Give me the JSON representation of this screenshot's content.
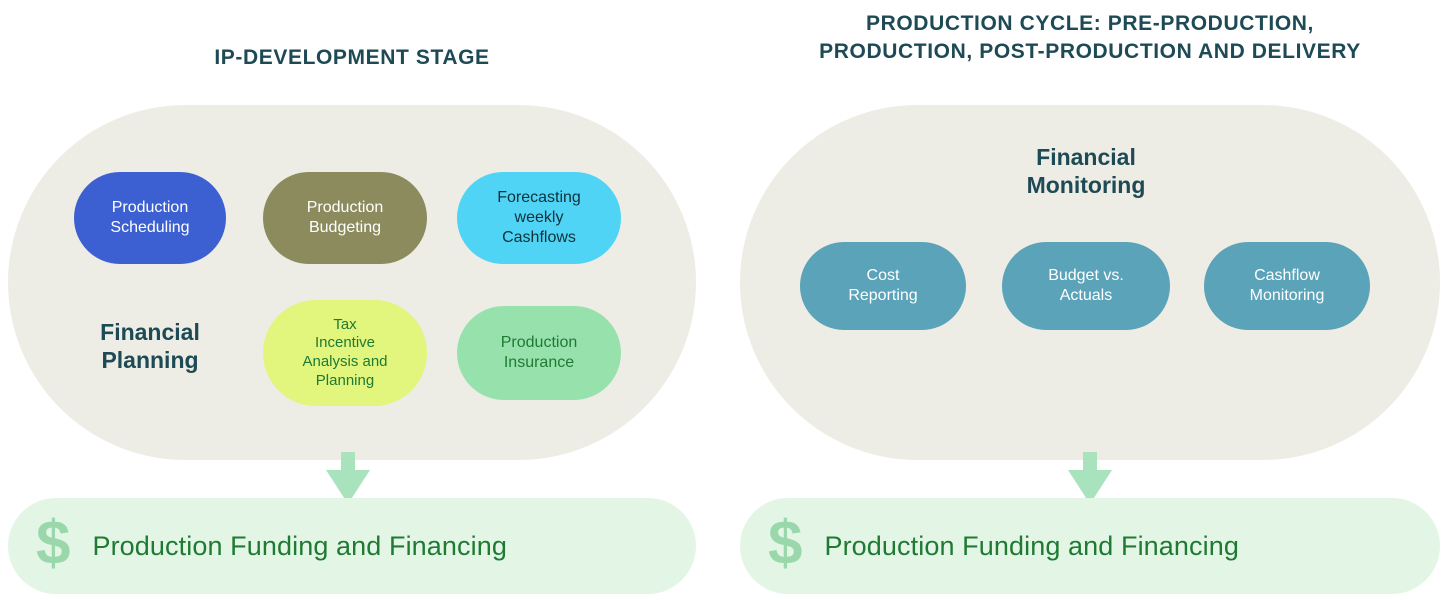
{
  "columns": [
    {
      "id": "ip-development",
      "title": "IP-DEVELOPMENT STAGE",
      "group_label": "Financial\nPlanning",
      "group_label_line1": "Financial",
      "group_label_line2": "Planning",
      "items": [
        {
          "label": "Production\nScheduling",
          "line1": "Production",
          "line2": "Scheduling",
          "color": "#3c60d1",
          "text_color": "#ffffff"
        },
        {
          "label": "Production\nBudgeting",
          "line1": "Production",
          "line2": "Budgeting",
          "color": "#8b8b5e",
          "text_color": "#ffffff"
        },
        {
          "label": "Forecasting\nweekly\nCashflows",
          "line1": "Forecasting",
          "line2": "weekly",
          "line3": "Cashflows",
          "color": "#4fd4f5",
          "text_color": "#10313a"
        },
        {
          "label": "Tax\nIncentive\nAnalysis and\nPlanning",
          "line1": "Tax",
          "line2": "Incentive",
          "line3": "Analysis and",
          "line4": "Planning",
          "color": "#e2f57d",
          "text_color": "#1f7a33"
        },
        {
          "label": "Production\nInsurance",
          "line1": "Production",
          "line2": "Insurance",
          "color": "#97e2ac",
          "text_color": "#1f7a33"
        }
      ],
      "footer": {
        "icon": "dollar-icon",
        "icon_glyph": "$",
        "label": "Production Funding and Financing"
      }
    },
    {
      "id": "production-cycle",
      "title": "PRODUCTION CYCLE: PRE-PRODUCTION, PRODUCTION, POST-PRODUCTION AND DELIVERY",
      "title_line1": "PRODUCTION CYCLE: PRE-PRODUCTION,",
      "title_line2": "PRODUCTION, POST-PRODUCTION AND DELIVERY",
      "group_label": "Financial\nMonitoring",
      "group_label_line1": "Financial",
      "group_label_line2": "Monitoring",
      "items": [
        {
          "label": "Cost\nReporting",
          "line1": "Cost",
          "line2": "Reporting",
          "color": "#5ba3b8",
          "text_color": "#ffffff"
        },
        {
          "label": "Budget vs.\nActuals",
          "line1": "Budget vs.",
          "line2": "Actuals",
          "color": "#5ba3b8",
          "text_color": "#ffffff"
        },
        {
          "label": "Cashflow\nMonitoring",
          "line1": "Cashflow",
          "line2": "Monitoring",
          "color": "#5ba3b8",
          "text_color": "#ffffff"
        }
      ],
      "footer": {
        "icon": "dollar-icon",
        "icon_glyph": "$",
        "label": "Production Funding and Financing"
      }
    }
  ],
  "colors": {
    "panel_background": "#edece5",
    "title_text": "#1d4a55",
    "group_label_text": "#1d4a55",
    "arrow": "#a8e3bd",
    "footer_background": "#e3f6e6",
    "footer_text": "#1f7a33",
    "footer_icon": "#9ad8ab",
    "page_background": "#ffffff"
  },
  "arrows": [
    {
      "id": "left-arrow",
      "direction": "down"
    },
    {
      "id": "right-arrow",
      "direction": "down"
    }
  ]
}
